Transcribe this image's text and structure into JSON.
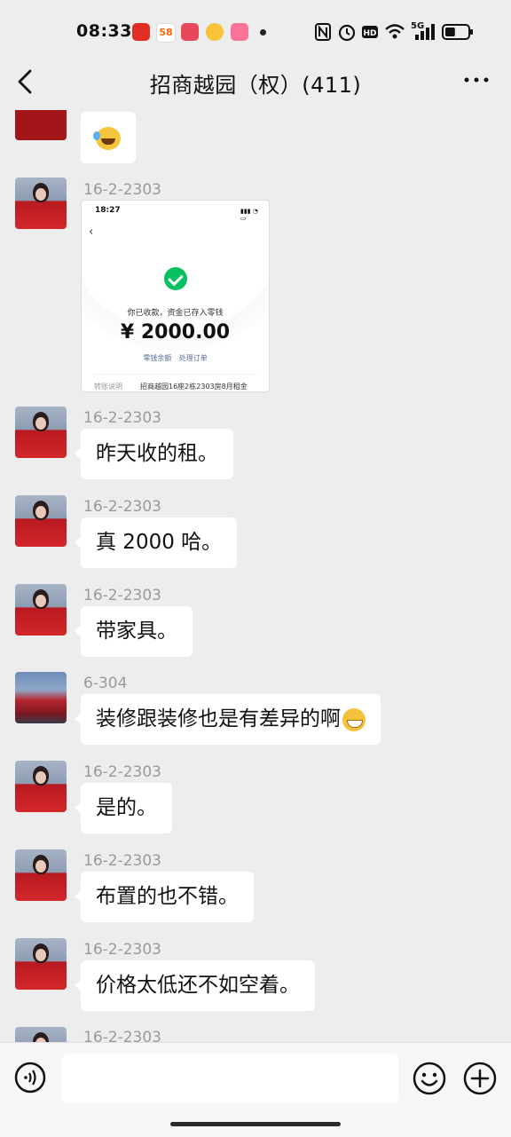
{
  "status_bar": {
    "time": "08:33",
    "network": "5G",
    "battery_level": 0.45,
    "app_icons": [
      "pinduoduo-icon",
      "58-icon",
      "baidu-local-icon",
      "weibo-icon",
      "bilibili-icon"
    ]
  },
  "nav": {
    "title": "招商越园（权）(411)"
  },
  "messages": [
    {
      "sender": "",
      "type": "emoji",
      "emoji": "laugh-cry-icon",
      "avatar": "logo"
    },
    {
      "sender": "16-2-2303",
      "type": "image",
      "avatar": "red",
      "image": {
        "time": "18:27",
        "status": "你已收款，资金已存入零钱",
        "amount": "¥ 2000.00",
        "links": "零钱余额 处理订单",
        "row_label": "转账说明",
        "row_value": "招商越园16座2栋2303房8月租金"
      }
    },
    {
      "sender": "16-2-2303",
      "type": "text",
      "text": "昨天收的租。",
      "avatar": "red"
    },
    {
      "sender": "16-2-2303",
      "type": "text",
      "text": "真 2000 哈。",
      "avatar": "red"
    },
    {
      "sender": "16-2-2303",
      "type": "text",
      "text": "带家具。",
      "avatar": "red"
    },
    {
      "sender": "6-304",
      "type": "text",
      "text": "装修跟装修也是有差异的啊",
      "emoji": "grin-icon",
      "avatar": "car"
    },
    {
      "sender": "16-2-2303",
      "type": "text",
      "text": "是的。",
      "avatar": "red"
    },
    {
      "sender": "16-2-2303",
      "type": "text",
      "text": "布置的也不错。",
      "avatar": "red"
    },
    {
      "sender": "16-2-2303",
      "type": "text",
      "text": "价格太低还不如空着。",
      "avatar": "red"
    },
    {
      "sender": "16-2-2303",
      "type": "partial",
      "avatar": "red"
    }
  ],
  "input": {
    "value": "",
    "placeholder": ""
  },
  "colors": {
    "background": "#ededed",
    "bubble": "#ffffff",
    "sender_name": "#9a9a9a",
    "accent_green": "#07c160"
  }
}
